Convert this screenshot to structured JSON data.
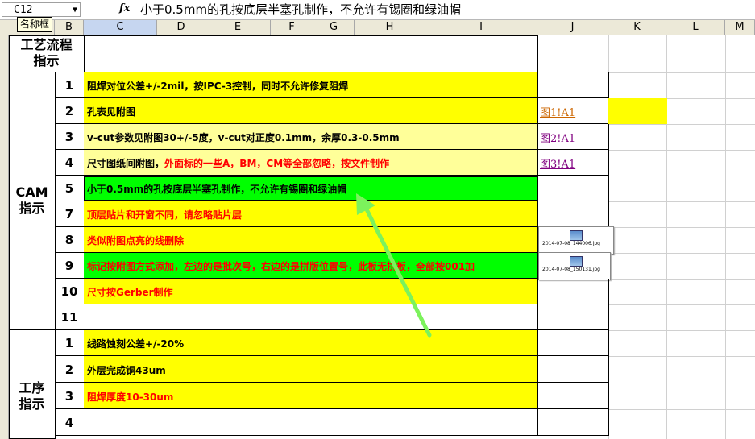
{
  "formula_bar": {
    "name_box": "C12",
    "tooltip": "名称框",
    "fx": "fx",
    "formula": "小于0.5mm的孔按底层半塞孔制作，不允许有锡圈和绿油帽"
  },
  "columns": [
    "B",
    "C",
    "D",
    "E",
    "F",
    "G",
    "H",
    "I",
    "J",
    "K",
    "L",
    "M"
  ],
  "sections": {
    "process": "工艺流程\n指示",
    "cam": "CAM\n指示",
    "step": "工序\n指示"
  },
  "rows": [
    {
      "num": "1",
      "text": "阻焊对位公差+/-2mil，按IPC-3控制，同时不允许修复阻焊",
      "color": "#000000"
    },
    {
      "num": "2",
      "text": "孔表见附图",
      "color": "#000000",
      "link": "图1!A1"
    },
    {
      "num": "3",
      "text": "v-cut参数见附图30+/-5度，v-cut对正度0.1mm，余厚0.3-0.5mm",
      "color": "#000000",
      "link": "图2!A1"
    },
    {
      "num": "4",
      "text": "尺寸图纸间附图，",
      "text2": "外面标的一些A，BM，CM等全部忽略，按文件制作",
      "color": "#000000",
      "color2": "#ff0000",
      "link": "图3!A1"
    },
    {
      "num": "5",
      "text": "小于0.5mm的孔按底层半塞孔制作，不允许有锡圈和绿油帽",
      "color": "#000000"
    },
    {
      "num": "7",
      "text": "顶层贴片和开窗不同，请忽略贴片层",
      "color": "#ff0000"
    },
    {
      "num": "8",
      "text": "类似附图点亮的线删除",
      "color": "#ff0000",
      "image": "2014-07-08_144006.jpg"
    },
    {
      "num": "9",
      "text": "标记按附图方式添加，左边的是批次号，右边的是拼版位置号，此板无拼板，全部按001加",
      "color": "#ff0000",
      "image": "2014-07-08_150131.jpg"
    },
    {
      "num": "10",
      "text": "尺寸按Gerber制作",
      "color": "#ff0000"
    },
    {
      "num": "11",
      "text": "",
      "color": "#000000"
    },
    {
      "num": "1",
      "text": "线路蚀刻公差+/-20%",
      "color": "#000000"
    },
    {
      "num": "2",
      "text": "外层完成铜43um",
      "color": "#000000"
    },
    {
      "num": "3",
      "text": "阻焊厚度10-30um",
      "color": "#ff0000"
    },
    {
      "num": "4",
      "text": "",
      "color": "#000000"
    }
  ],
  "colors": {
    "yellow": "#ffff00",
    "light_yellow": "#ffff99",
    "green": "#00ff00",
    "link_color": "#800080",
    "arrow": "#7cf25c"
  }
}
